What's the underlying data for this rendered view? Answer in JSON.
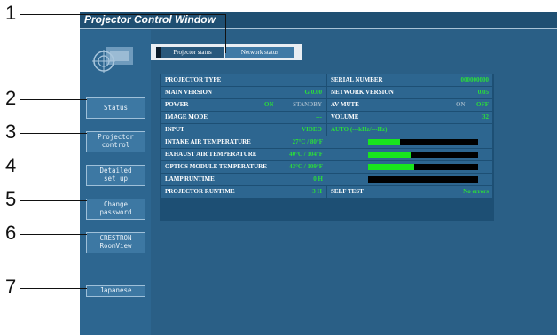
{
  "callouts": [
    "1",
    "2",
    "3",
    "4",
    "5",
    "6",
    "7"
  ],
  "window": {
    "title": "Projector Control Window"
  },
  "sidebar": {
    "buttons": [
      "Status",
      "Projector\ncontrol",
      "Detailed\nset up",
      "Change\npassword",
      "CRESTRON\nRoomView",
      "Japanese"
    ]
  },
  "tabs": {
    "projector_status": "Projector status",
    "network_status": "Network status"
  },
  "status": {
    "projector_type_label": "PROJECTOR TYPE",
    "serial_number_label": "SERIAL NUMBER",
    "serial_number_value": "000000000",
    "main_version_label": "MAIN VERSION",
    "main_version_value": "G 0.00",
    "network_version_label": "NETWORK VERSION",
    "network_version_value": "0.05",
    "power_label": "POWER",
    "power_on": "ON",
    "power_standby": "STANDBY",
    "av_mute_label": "AV MUTE",
    "av_mute_on": "ON",
    "av_mute_off": "OFF",
    "image_mode_label": "IMAGE MODE",
    "image_mode_value": "---",
    "volume_label": "VOLUME",
    "volume_value": "32",
    "input_label": "INPUT",
    "input_value": "VIDEO",
    "input_detail": "AUTO (---kHz/---Hz)",
    "intake_label": "INTAKE AIR TEMPERATURE",
    "intake_value": "27°C / 80°F",
    "intake_level": 0.29,
    "exhaust_label": "EXHAUST AIR TEMPERATURE",
    "exhaust_value": "40°C / 104°F",
    "exhaust_level": 0.39,
    "optics_label": "OPTICS MODULE TEMPERATURE",
    "optics_value": "43°C / 109°F",
    "optics_level": 0.42,
    "lamp_label": "LAMP RUNTIME",
    "lamp_value": "0 H",
    "lamp_level": 0.0,
    "runtime_label": "PROJECTOR RUNTIME",
    "runtime_value": "3 H",
    "self_test_label": "SELF TEST",
    "self_test_value": "No errors"
  },
  "colors": {
    "value_green": "#2bde3a",
    "bar_green": "#19e51e"
  }
}
